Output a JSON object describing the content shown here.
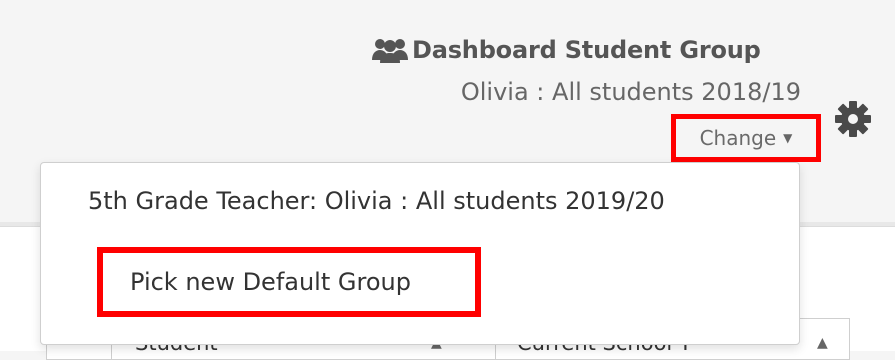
{
  "group_header": {
    "title": "Dashboard Student Group",
    "subtitle": "Olivia : All students 2018/19",
    "change_label": "Change",
    "icon": "users-icon"
  },
  "settings": {
    "icon": "gear-icon"
  },
  "dropdown": {
    "items": [
      {
        "label": "5th Grade Teacher: Olivia : All students 2019/20"
      },
      {
        "label": "Pick new Default Group"
      }
    ]
  },
  "table": {
    "columns": [
      {
        "label": "Student"
      },
      {
        "label": "Current School Y"
      }
    ]
  },
  "colors": {
    "highlight": "#ff0000",
    "text_primary": "#333333",
    "text_muted": "#666666"
  }
}
